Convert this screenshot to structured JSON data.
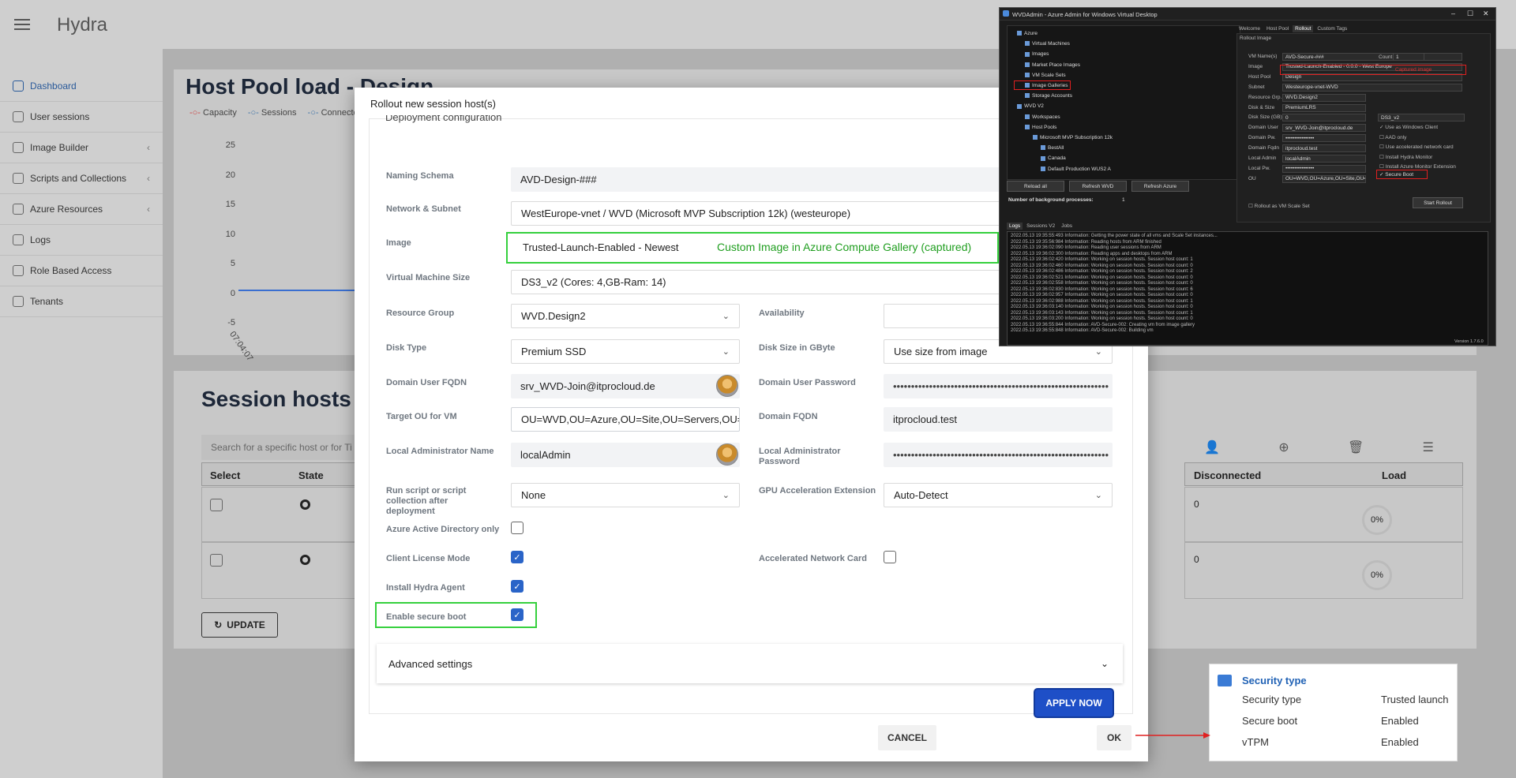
{
  "app": {
    "title": "Hydra",
    "sidebar": [
      {
        "label": "Dashboard",
        "icon": "dashboard-icon",
        "chevron": false,
        "active": true
      },
      {
        "label": "User sessions",
        "icon": "user-icon",
        "chevron": false,
        "active": false
      },
      {
        "label": "Image Builder",
        "icon": "image-icon",
        "chevron": true,
        "active": false
      },
      {
        "label": "Scripts and Collections",
        "icon": "script-icon",
        "chevron": true,
        "active": false
      },
      {
        "label": "Azure Resources",
        "icon": "azure-icon",
        "chevron": true,
        "active": false
      },
      {
        "label": "Logs",
        "icon": "book-icon",
        "chevron": false,
        "active": false
      },
      {
        "label": "Role Based Access",
        "icon": "shield-icon",
        "chevron": false,
        "active": false
      },
      {
        "label": "Tenants",
        "icon": "gear-icon",
        "chevron": false,
        "active": false
      }
    ],
    "card1": {
      "title": "Host Pool load - Design",
      "legend": [
        "Capacity",
        "Sessions",
        "Connected"
      ],
      "y_ticks": [
        "25",
        "20",
        "15",
        "10",
        "5",
        "0",
        "-5"
      ],
      "x_tick": "07:04:07"
    },
    "card2": {
      "title": "Session hosts",
      "search_placeholder": "Search for a specific host or for Ti",
      "columns": {
        "select": "Select",
        "state": "State",
        "disconnected": "Disconnected",
        "load": "Load"
      },
      "rows": [
        {
          "disconnected": "0",
          "load": "0%"
        },
        {
          "disconnected": "0",
          "load": "0%"
        }
      ],
      "update_label": "UPDATE"
    }
  },
  "modal": {
    "title": "Rollout new session host(s)",
    "section_heading": "Deployment configuration",
    "fields": {
      "naming_schema": {
        "label": "Naming Schema",
        "value": "AVD-Design-###"
      },
      "network": {
        "label": "Network & Subnet",
        "value": "WestEurope-vnet / WVD (Microsoft MVP Subscription 12k) (westeurope)"
      },
      "image": {
        "label": "Image",
        "value": "Trusted-Launch-Enabled - Newest",
        "annotation": "Custom Image in Azure Compute Gallery (captured)"
      },
      "vm_size": {
        "label": "Virtual Machine Size",
        "value": "DS3_v2 (Cores: 4,GB-Ram: 14)"
      },
      "resource_group": {
        "label": "Resource Group",
        "value": "WVD.Design2"
      },
      "availability": {
        "label": "Availability",
        "value": ""
      },
      "disk_type": {
        "label": "Disk Type",
        "value": "Premium SSD"
      },
      "disk_size": {
        "label": "Disk Size in GByte",
        "value": "Use size from image"
      },
      "domain_user": {
        "label": "Domain User FQDN",
        "value": "srv_WVD-Join@itprocloud.de"
      },
      "domain_password": {
        "label": "Domain User Password",
        "value": "••••••••••••••••••••••••••••••••••••••••••••••••••••••••••••"
      },
      "target_ou": {
        "label": "Target OU for VM",
        "value": "OU=WVD,OU=Azure,OU=Site,OU=Servers,OU="
      },
      "domain_fqdn": {
        "label": "Domain FQDN",
        "value": "itprocloud.test"
      },
      "local_admin": {
        "label": "Local Administrator Name",
        "value": "localAdmin"
      },
      "local_admin_pw": {
        "label": "Local Administrator Password",
        "value": "••••••••••••••••••••••••••••••••••••••••••••••••••••••••••••"
      },
      "run_script": {
        "label": "Run script or script collection after deployment",
        "value": "None"
      },
      "gpu": {
        "label": "GPU Acceleration Extension",
        "value": "Auto-Detect"
      }
    },
    "checks": {
      "aad_only": {
        "label": "Azure Active Directory only",
        "checked": false
      },
      "client_license": {
        "label": "Client License Mode",
        "checked": true
      },
      "accel_network": {
        "label": "Accelerated Network Card",
        "checked": false
      },
      "hydra_agent": {
        "label": "Install Hydra Agent",
        "checked": true
      },
      "secure_boot": {
        "label": "Enable secure boot",
        "checked": true
      }
    },
    "advanced_label": "Advanced settings",
    "apply_label": "APPLY NOW",
    "cancel_label": "CANCEL",
    "ok_label": "OK"
  },
  "wvdadmin": {
    "title": "WVDAdmin - Azure Admin for Windows Virtual Desktop",
    "tabs": [
      "Welcome",
      "Host Pool",
      "Rollout",
      "Custom Tags"
    ],
    "tree": [
      {
        "label": "Azure",
        "indent": 0
      },
      {
        "label": "Virtual Machines",
        "indent": 1
      },
      {
        "label": "Images",
        "indent": 1
      },
      {
        "label": "Market Place Images",
        "indent": 1
      },
      {
        "label": "VM Scale Sets",
        "indent": 1
      },
      {
        "label": "Image Galleries",
        "indent": 1
      },
      {
        "label": "Storage Accounts",
        "indent": 1
      },
      {
        "label": "WVD V2",
        "indent": 0
      },
      {
        "label": "Workspaces",
        "indent": 1
      },
      {
        "label": "Host Pools",
        "indent": 1
      },
      {
        "label": "Microsoft MVP Subscription 12k",
        "indent": 2
      },
      {
        "label": "BestAll",
        "indent": 3
      },
      {
        "label": "Canada",
        "indent": 3
      },
      {
        "label": "Default Production WUS2 A",
        "indent": 3
      }
    ],
    "buttons": {
      "reload_all": "Reload all",
      "refresh_wvd": "Refresh WVD",
      "refresh_azure": "Refresh Azure",
      "start_rollout": "Start Rollout"
    },
    "bg_label": "Number of background processes:",
    "bg_value": "1",
    "rollout_panel": "Rollout Image",
    "rollout_fields": [
      {
        "label": "VM Name(s)",
        "value": "AVD-Secure-###"
      },
      {
        "label": "Image",
        "value": "Trusted-Launch-Enabled - 0.0.0 - West Europe"
      },
      {
        "label": "Host Pool",
        "value": "Design"
      },
      {
        "label": "Subnet",
        "value": "Westeurope-vnet-WVD"
      },
      {
        "label": "Resource Grp.",
        "value": "WVD.Design2"
      },
      {
        "label": "Disk & Size",
        "value": "PremiumLRS"
      },
      {
        "label": "Disk Size (GB)",
        "value": "0"
      },
      {
        "label": "Domain User",
        "value": "srv_WVD-Join@itprocloud.de"
      },
      {
        "label": "Domain Pw.",
        "value": "••••••••••••••••"
      },
      {
        "label": "Domain Fqdn",
        "value": "itprocloud.test"
      },
      {
        "label": "Local Admin",
        "value": "localAdmin"
      },
      {
        "label": "Local Pw.",
        "value": "••••••••••••••••"
      },
      {
        "label": "OU",
        "value": "OU=WVD,OU=Azure,OU=Site,OU=Se"
      }
    ],
    "count_label": "Count",
    "count_value": "1",
    "captured_label": "Captured image",
    "vm_size": "DS3_v2",
    "options": [
      "Use as Windows Client",
      "AAD only",
      "Use accelerated network card",
      "Install Hydra Monitor",
      "Install Azure Monitor Extension"
    ],
    "secure_boot": "Secure Boot",
    "rollout_vmss": "Rollout as VM Scale Set",
    "log_tabs": [
      "Logs",
      "Sessions V2",
      "Jobs"
    ],
    "log_lines": [
      "2022.05.13 19:35:55:493 Information: Getting the power state of all vms and Scale Set instances...",
      "2022.05.13 19:35:56:984 Information: Reading hosts from ARM finished",
      "2022.05.13 19:36:02:090 Information: Reading user sessions from ARM",
      "2022.05.13 19:36:02:300 Information: Reading apps and desktops from ARM",
      "2022.05.13 19:36:02:420 Information: Working on session hosts. Session host count: 1",
      "2022.05.13 19:36:02:460 Information: Working on session hosts. Session host count: 0",
      "2022.05.13 19:36:02:486 Information: Working on session hosts. Session host count: 2",
      "2022.05.13 19:36:02:521 Information: Working on session hosts. Session host count: 0",
      "2022.05.13 19:36:02:558 Information: Working on session hosts. Session host count: 0",
      "2022.05.13 19:36:02:830 Information: Working on session hosts. Session host count: 6",
      "2022.05.13 19:36:02:957 Information: Working on session hosts. Session host count: 0",
      "2022.05.13 19:36:02:988 Information: Working on session hosts. Session host count: 1",
      "2022.05.13 19:36:03:140 Information: Working on session hosts. Session host count: 0",
      "2022.05.13 19:36:03:143 Information: Working on session hosts. Session host count: 1",
      "2022.05.13 19:36:03:200 Information: Working on session hosts. Session host count: 0",
      "2022.05.13 19:36:55:844 Information: AVD-Secure-002: Creating vm from image gallery",
      "2022.05.13 19:36:55:848 Information: AVD-Secure-002: Building vm"
    ],
    "version": "Version 1.7.6.0"
  },
  "security": {
    "title": "Security type",
    "rows": [
      {
        "label": "Security type",
        "value": "Trusted launch"
      },
      {
        "label": "Secure boot",
        "value": "Enabled"
      },
      {
        "label": "vTPM",
        "value": "Enabled"
      }
    ]
  },
  "colors": {
    "accent": "#2a64c8",
    "apply": "#1e4fc7",
    "highlight_green": "#35d03d",
    "annotation_green": "#1f9e1f",
    "highlight_red": "#e02020",
    "security_title": "#2162b5"
  }
}
